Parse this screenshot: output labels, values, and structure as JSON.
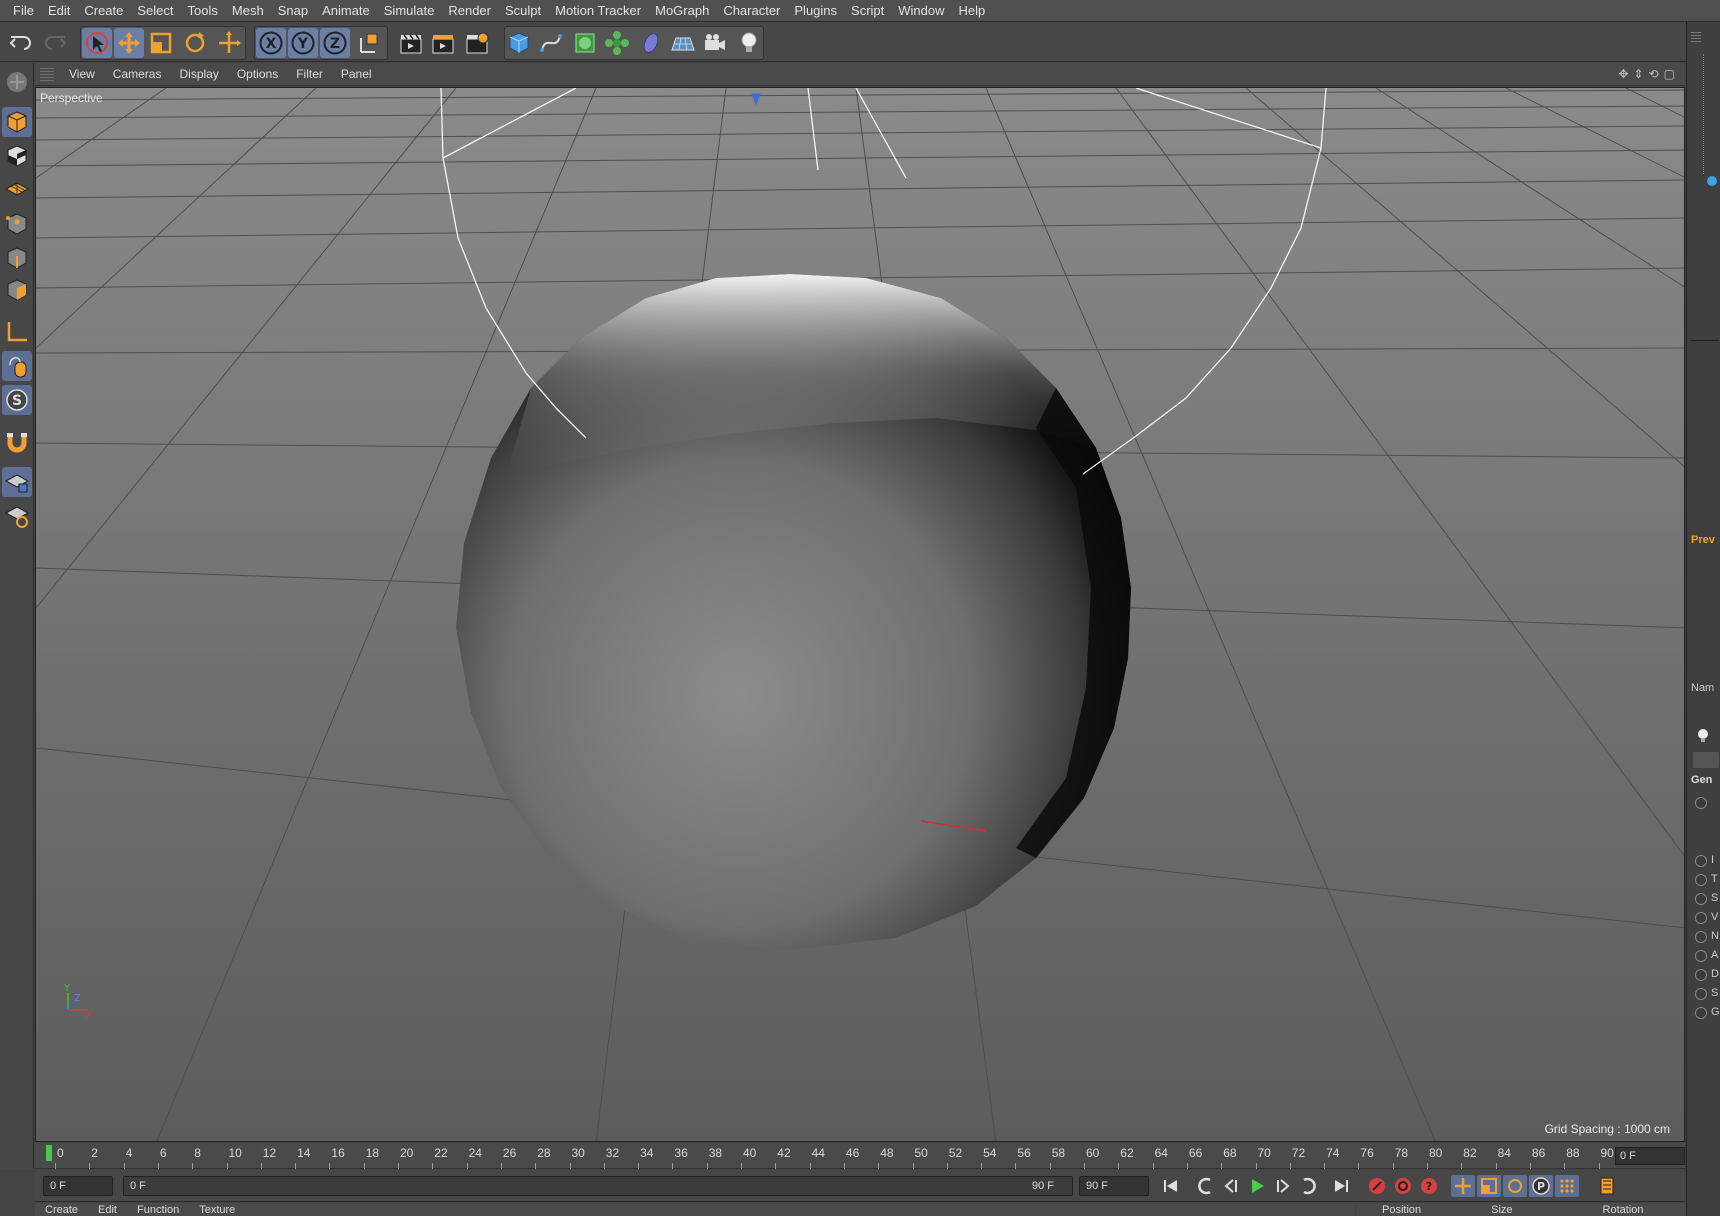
{
  "menubar": {
    "items": [
      "File",
      "Edit",
      "Create",
      "Select",
      "Tools",
      "Mesh",
      "Snap",
      "Animate",
      "Simulate",
      "Render",
      "Sculpt",
      "Motion Tracker",
      "MoGraph",
      "Character",
      "Plugins",
      "Script",
      "Window",
      "Help"
    ]
  },
  "viewport": {
    "menu": [
      "View",
      "Cameras",
      "Display",
      "Options",
      "Filter",
      "Panel"
    ],
    "label": "Perspective",
    "grid_spacing": "Grid Spacing : 1000 cm",
    "axis_y": "Y",
    "axis_z": "Z",
    "axis_x": "X"
  },
  "timeline": {
    "ticks": [
      "0",
      "2",
      "4",
      "6",
      "8",
      "10",
      "12",
      "14",
      "16",
      "18",
      "20",
      "22",
      "24",
      "26",
      "28",
      "30",
      "32",
      "34",
      "36",
      "38",
      "40",
      "42",
      "44",
      "46",
      "48",
      "50",
      "52",
      "54",
      "56",
      "58",
      "60",
      "62",
      "64",
      "66",
      "68",
      "70",
      "72",
      "74",
      "76",
      "78",
      "80",
      "82",
      "84",
      "86",
      "88",
      "90"
    ],
    "current_frame": "0 F"
  },
  "transport": {
    "start_field": "0 F",
    "range_start": "0 F",
    "range_end": "90 F",
    "end_field": "90 F"
  },
  "bottom": {
    "materials_menu": [
      "Create",
      "Edit",
      "Function",
      "Texture"
    ],
    "coords_headers": [
      "Position",
      "Size",
      "Rotation"
    ]
  },
  "rightpanel": {
    "preview_label": "Prev",
    "name_label": "Nam",
    "general_label": "Gen",
    "attr_letters": [
      "I",
      "T",
      "S",
      "V",
      "N",
      "A",
      "D",
      "S",
      "G"
    ]
  },
  "colors": {
    "accent_orange": "#f0a030",
    "active_blue": "#6b7fa6",
    "play_green": "#4ccc4c",
    "record_red": "#d84040"
  }
}
